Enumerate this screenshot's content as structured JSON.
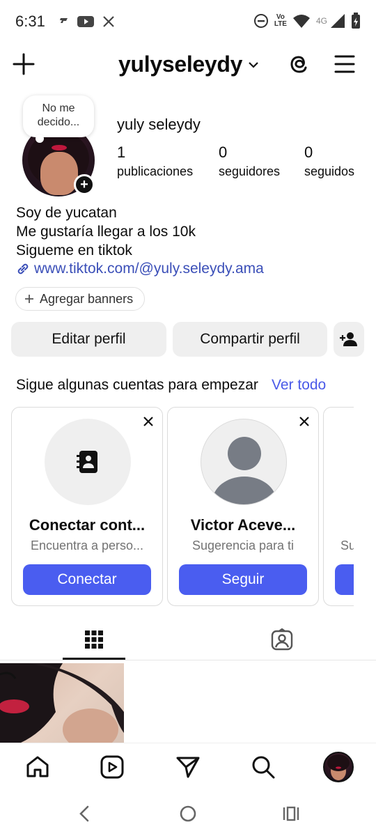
{
  "status_bar": {
    "time": "6:31",
    "volte_line1": "Vo",
    "volte_line2": "LTE",
    "network": "4G"
  },
  "header": {
    "username": "yulyseleydy"
  },
  "profile": {
    "note": "No me decido...",
    "full_name": "yuly seleydy",
    "stats": [
      {
        "value": "1",
        "label": "publicaciones"
      },
      {
        "value": "0",
        "label": "seguidores"
      },
      {
        "value": "0",
        "label": "seguidos"
      }
    ],
    "bio_lines": [
      "Soy de yucatan",
      "Me gustaría llegar a los 10k",
      "Sigueme en tiktok"
    ],
    "link": "www.tiktok.com/@yuly.seleydy.ama",
    "banners_label": "Agregar banners"
  },
  "actions": {
    "edit": "Editar perfil",
    "share": "Compartir perfil"
  },
  "suggestions": {
    "title": "Sigue algunas cuentas para empezar",
    "see_all": "Ver todo",
    "cards": [
      {
        "name": "Conectar cont...",
        "subtitle": "Encuentra a perso...",
        "button": "Conectar",
        "icon": "contacts-book-icon"
      },
      {
        "name": "Victor Aceve...",
        "subtitle": "Sugerencia para ti",
        "button": "Seguir",
        "icon": "default-avatar-icon"
      },
      {
        "name": "",
        "subtitle": "Su",
        "button": "",
        "icon": ""
      }
    ]
  },
  "tabs": [
    {
      "icon": "grid-icon",
      "active": true
    },
    {
      "icon": "tagged-icon",
      "active": false
    }
  ],
  "bottom_nav": [
    "home-icon",
    "reels-icon",
    "send-icon",
    "search-icon",
    "profile-avatar"
  ],
  "colors": {
    "accent": "#4a5df0",
    "link": "#3b4fb8",
    "button_bg": "#efefef"
  }
}
